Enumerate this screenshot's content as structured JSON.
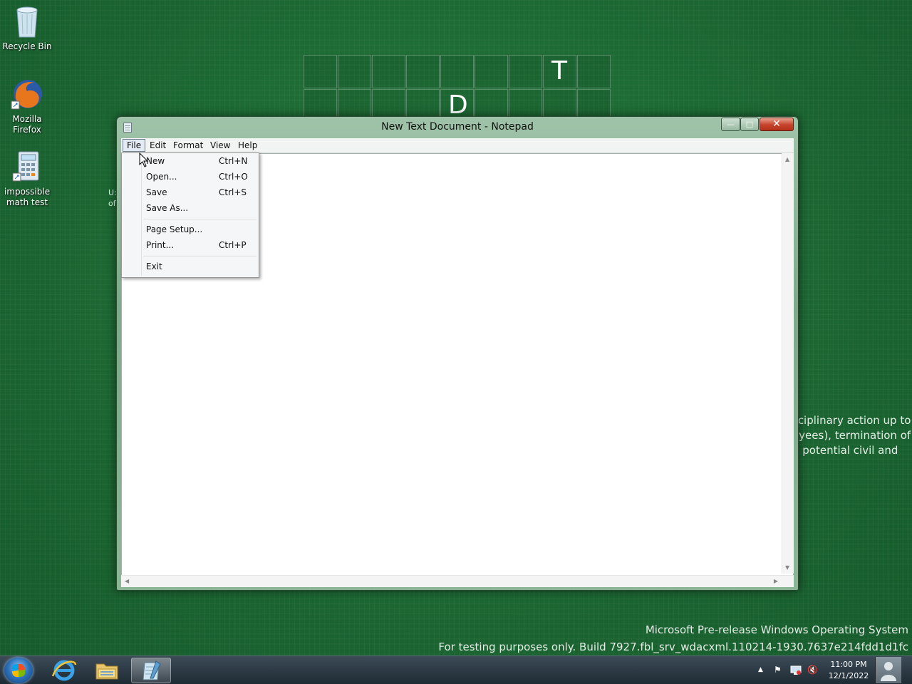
{
  "desktop": {
    "icons": [
      {
        "label_line1": "Recycle Bin",
        "label_line2": ""
      },
      {
        "label_line1": "Mozilla",
        "label_line2": "Firefox"
      },
      {
        "label_line1": "impossible",
        "label_line2": "math test"
      }
    ],
    "stray_text_1": "U:",
    "stray_text_2": "of",
    "grid_letters": [
      "T",
      "D"
    ],
    "bg_text_lines": [
      "sciplinary action up to",
      "oyees), termination of",
      "d potential civil and"
    ],
    "watermark_line1": "Microsoft Pre-release Windows Operating System",
    "watermark_line2": "For testing purposes only. Build 7927.fbl_srv_wdacxml.110214-1930.7637e214fdd1d1fc"
  },
  "window": {
    "title": "New Text Document - Notepad",
    "controls": {
      "minimize": "—",
      "maximize": "□",
      "close": "✕"
    },
    "menu": [
      "File",
      "Edit",
      "Format",
      "View",
      "Help"
    ],
    "editor_text": ""
  },
  "file_menu": {
    "items": [
      {
        "label": "New",
        "shortcut": "Ctrl+N"
      },
      {
        "label": "Open...",
        "shortcut": "Ctrl+O"
      },
      {
        "label": "Save",
        "shortcut": "Ctrl+S"
      },
      {
        "label": "Save As...",
        "shortcut": ""
      },
      {
        "label": "Page Setup...",
        "shortcut": ""
      },
      {
        "label": "Print...",
        "shortcut": "Ctrl+P"
      },
      {
        "label": "Exit",
        "shortcut": ""
      }
    ]
  },
  "taskbar": {
    "clock_time": "11:00 PM",
    "clock_date": "12/1/2022",
    "tray_up": "▲",
    "tray_flag": "⚑",
    "tray_speaker": "🔇",
    "pinned": [
      "internet-explorer",
      "windows-explorer",
      "notepad"
    ]
  }
}
